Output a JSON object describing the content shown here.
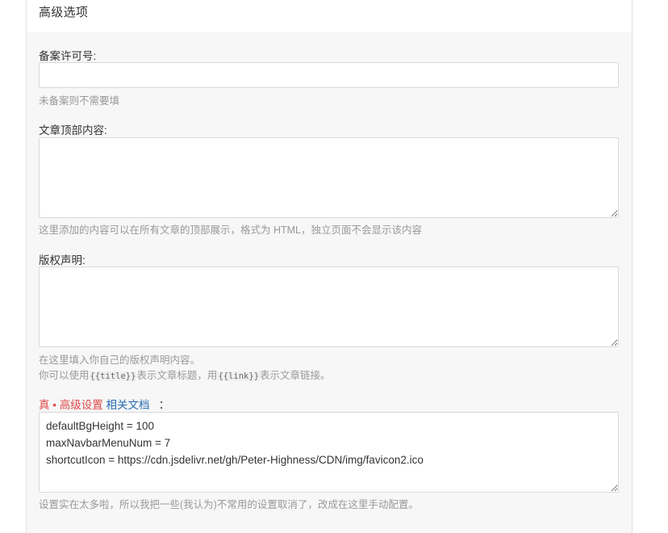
{
  "section": {
    "title": "高级选项"
  },
  "icp": {
    "label": "备案许可号:",
    "value": "",
    "help": "未备案则不需要填"
  },
  "post_top": {
    "label": "文章顶部内容:",
    "value": "",
    "help": "这里添加的内容可以在所有文章的顶部展示，格式为 HTML，独立页面不会显示该内容"
  },
  "copyright": {
    "label": "版权声明:",
    "value": "",
    "help_line1": "在这里填入你自己的版权声明内容。",
    "help_line2_prefix": "你可以使用",
    "help_line2_code1": "{{title}}",
    "help_line2_mid": "表示文章标题，用",
    "help_line2_code2": "{{link}}",
    "help_line2_suffix": "表示文章链接。"
  },
  "advanced": {
    "label_red": "真 • 高级设置",
    "label_link": "相关文档",
    "label_colon": "：",
    "value": "defaultBgHeight = 100\nmaxNavbarMenuNum = 7\nshortcutIcon = https://cdn.jsdelivr.net/gh/Peter-Highness/CDN/img/favicon2.ico",
    "help": "设置实在太多啦，所以我把一些(我认为)不常用的设置取消了，改成在这里手动配置。"
  },
  "colors": {
    "panel_bg": "#f7f7f7",
    "accent_red": "#e04a4a",
    "link_blue": "#2a6db0",
    "help_gray": "#999999"
  }
}
